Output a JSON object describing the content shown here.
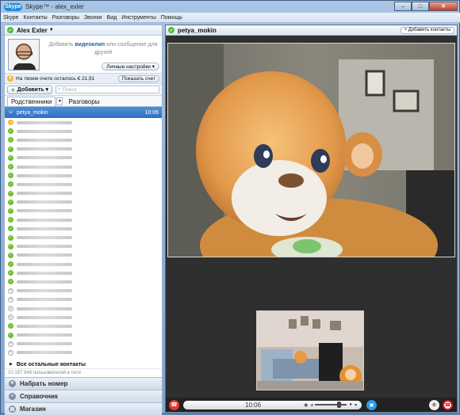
{
  "window": {
    "app": "Skype",
    "title": "Skype™ - alex_exler",
    "min": "–",
    "max": "□",
    "close": "✕"
  },
  "menu": [
    "Skype",
    "Контакты",
    "Разговоры",
    "Звонки",
    "Вид",
    "Инструменты",
    "Помощь"
  ],
  "profile": {
    "name": "Alex Exler",
    "mood_before": "Добавить ",
    "mood_link": "видеоклип",
    "mood_after": " или сообщение для друзей",
    "settings_button": "Личные настройки ▾"
  },
  "credit": {
    "text": "На твоем счете осталось € 21,91",
    "button": "Показать счет"
  },
  "toolbar": {
    "add_button": "Добавить ▾",
    "search_placeholder": "Поиск"
  },
  "tabs": {
    "relatives": "Родственники",
    "dropdown": "▼",
    "conversations": "Разговоры"
  },
  "contacts": {
    "selected": {
      "name": "petya_mokin",
      "time": "10:06",
      "status": "phone"
    },
    "others_label": "Все остальные контакты",
    "others_arrow": "▶",
    "users_online": "10 157 846 пользователей в сети"
  },
  "bottom": {
    "dial": "Набрать номер",
    "help": "Справочник",
    "shop": "Магазин"
  },
  "conversation": {
    "name": "petya_mokin",
    "add_contacts": "+ Добавить контакты",
    "timer": "10:06"
  },
  "colors": {
    "online": "#6bbf2a",
    "away": "#f0b323",
    "end_call": "#e23a2e",
    "accent": "#2f6fc0"
  }
}
